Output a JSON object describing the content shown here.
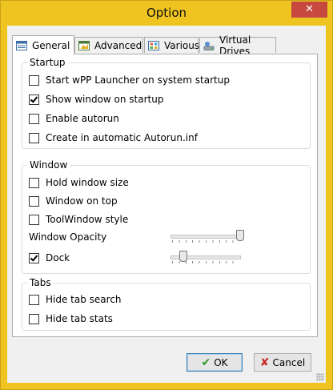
{
  "window": {
    "title": "Option",
    "close_glyph": "✕"
  },
  "tabs": [
    {
      "label": "General",
      "icon": "general-tab-icon",
      "active": true
    },
    {
      "label": "Advanced",
      "icon": "advanced-tab-icon",
      "active": false
    },
    {
      "label": "Various",
      "icon": "various-tab-icon",
      "active": false
    },
    {
      "label": "Virtual Drives",
      "icon": "virtual-drives-tab-icon",
      "active": false
    }
  ],
  "startup": {
    "title": "Startup",
    "options": [
      {
        "label": "Start wPP Launcher on system startup",
        "checked": false
      },
      {
        "label": "Show window on startup",
        "checked": true
      },
      {
        "label": "Enable autorun",
        "checked": false
      },
      {
        "label": "Create in automatic Autorun.inf",
        "checked": false
      }
    ]
  },
  "window_group": {
    "title": "Window",
    "hold_size": {
      "label": "Hold window size",
      "checked": false
    },
    "on_top": {
      "label": "Window on top",
      "checked": false
    },
    "toolwindow": {
      "label": "ToolWindow style",
      "checked": false
    },
    "opacity_label": "Window Opacity",
    "opacity_level": 1.0,
    "dock": {
      "label": "Dock",
      "checked": true
    },
    "dock_level": 0.15
  },
  "tabs_group": {
    "title": "Tabs",
    "hide_search": {
      "label": "Hide tab search",
      "checked": false
    },
    "hide_stats": {
      "label": "Hide tab stats",
      "checked": false
    }
  },
  "buttons": {
    "ok": "OK",
    "ok_glyph": "✔",
    "cancel": "Cancel",
    "cancel_glyph": "✘"
  },
  "colors": {
    "frame": "#f0c420",
    "close": "#c7483f",
    "ok_check": "#2e9b2e",
    "cancel_x": "#c62828"
  }
}
